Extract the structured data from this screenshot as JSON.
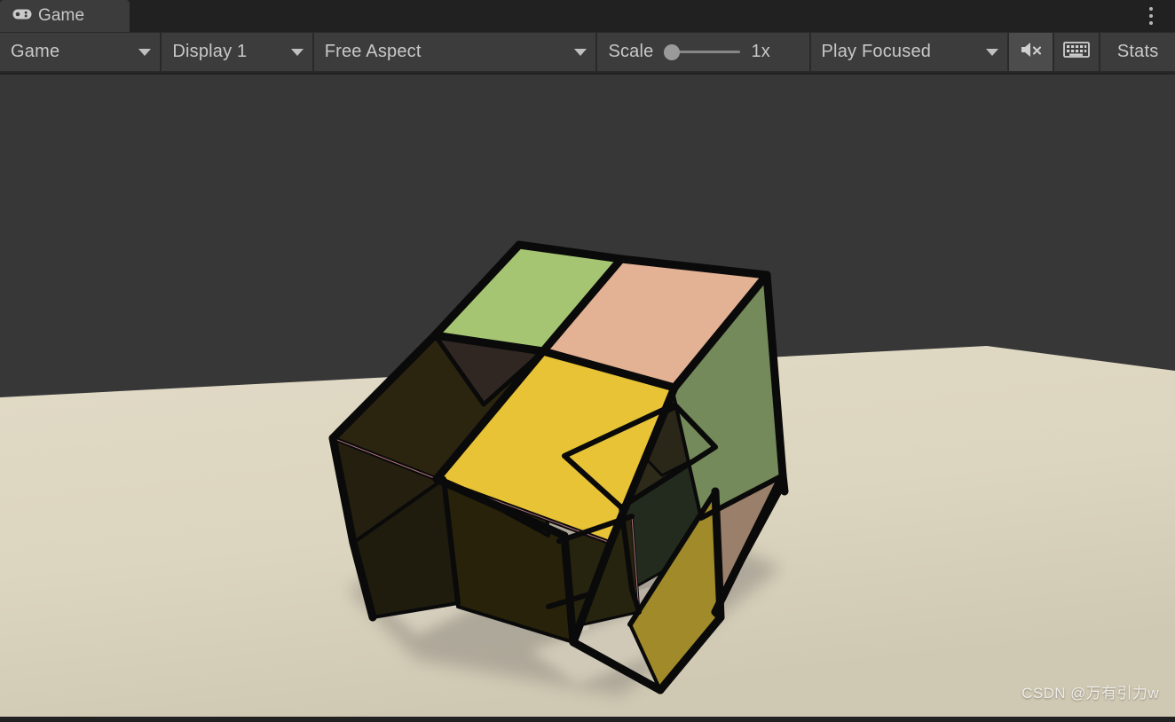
{
  "window": {
    "tab_label": "Game",
    "tab_icon": "gamepad-icon",
    "overflow_menu_icon": "kebab-menu-icon"
  },
  "toolbar": {
    "view_mode": {
      "label": "Game",
      "icon": "chevron-down-icon"
    },
    "display": {
      "label": "Display 1",
      "icon": "chevron-down-icon"
    },
    "aspect": {
      "label": "Free Aspect",
      "icon": "chevron-down-icon"
    },
    "scale": {
      "label": "Scale",
      "value": "1x",
      "slider_position_pct": 4
    },
    "play_mode": {
      "label": "Play Focused",
      "icon": "chevron-down-icon"
    },
    "mute_audio": {
      "icon": "mute-audio-icon",
      "active": true
    },
    "gizmos": {
      "icon": "gizmos-grid-icon",
      "active": false
    },
    "stats": {
      "label": "Stats"
    }
  },
  "viewport": {
    "background_color": "#373737",
    "ground_color": "#ddd6c0",
    "ground_shade_color": "#cfc7b0",
    "shadow_color": "#a59f92",
    "shadow_light_color": "#ded7c4",
    "watermark": "CSDN @万有引力w",
    "scene_name": "rubiks-cube-scene"
  },
  "cube": {
    "wire_color": "#0a0a0a",
    "selection_outline_color": "#d08898",
    "faces": {
      "top_green": "#a5c572",
      "top_peach": "#e3b193",
      "top_yellow": "#e8c336",
      "top_dark_olive": "#2b2510",
      "top_dark_brown": "#312722",
      "right_olive_green": "#748a5a",
      "right_tan": "#9a7f6a",
      "right_gold": "#a08a2a",
      "front_dark_olive": "#23200e",
      "front_dark_green": "#222b1e",
      "front_shadow": "#1d1a10",
      "inner_dark": "#2e2a1a",
      "inner_hole_a": "#a7a096",
      "inner_hole_b": "#cfc8b8"
    }
  }
}
